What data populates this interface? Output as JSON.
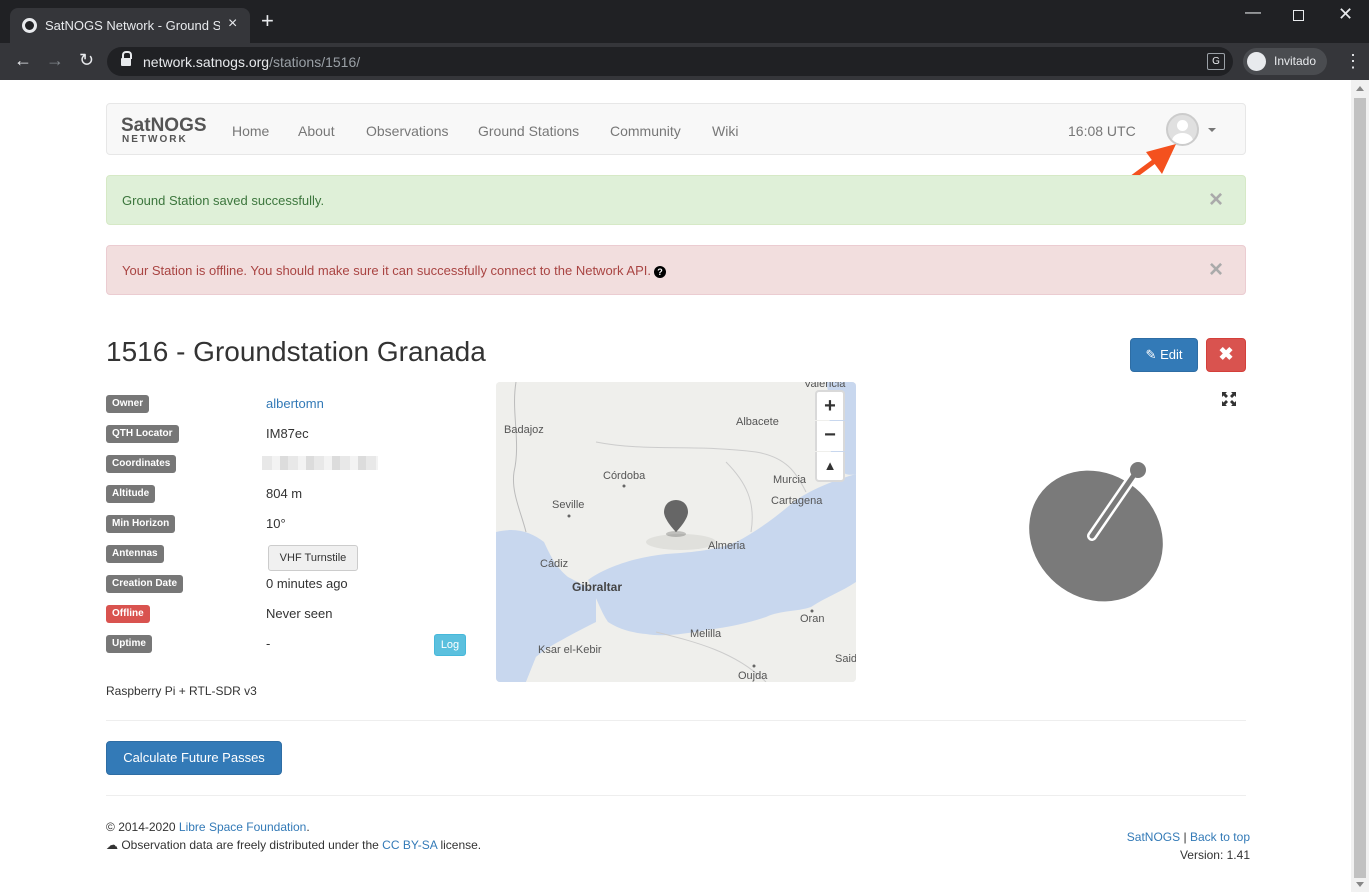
{
  "browser": {
    "tab_title": "SatNOGS Network - Ground Stati",
    "url_host": "network.satnogs.org",
    "url_path": "/stations/1516/",
    "profile_label": "Invitado"
  },
  "navbar": {
    "brand_top": "SatNOGS",
    "brand_bottom": "NETWORK",
    "links": [
      "Home",
      "About",
      "Observations",
      "Ground Stations",
      "Community",
      "Wiki"
    ],
    "clock": "16:08 UTC"
  },
  "alerts": {
    "success": "Ground Station saved successfully.",
    "danger": "Your Station is offline. You should make sure it can successfully connect to the Network API."
  },
  "station": {
    "title": "1516 - Groundstation Granada",
    "edit_label": "Edit",
    "delete_label": "✖",
    "fields": [
      {
        "label": "Owner",
        "value": "albertomn"
      },
      {
        "label": "QTH Locator",
        "value": "IM87ec"
      },
      {
        "label": "Coordinates",
        "value": ""
      },
      {
        "label": "Altitude",
        "value": "804 m"
      },
      {
        "label": "Min Horizon",
        "value": "10°"
      },
      {
        "label": "Antennas",
        "value": "VHF Turnstile"
      },
      {
        "label": "Creation Date",
        "value": "0 minutes ago"
      },
      {
        "label": "Offline",
        "value": "Never seen"
      },
      {
        "label": "Uptime",
        "value": "-"
      }
    ],
    "log_label": "Log",
    "description": "Raspberry Pi + RTL-SDR v3"
  },
  "map": {
    "cities": [
      "Valencia",
      "Badajoz",
      "Albacete",
      "Córdoba",
      "Murcia",
      "Seville",
      "Cartagena",
      "Almeria",
      "Cádiz",
      "Gibraltar",
      "Oran",
      "Melilla",
      "Ksar el-Kebir",
      "Said",
      "Oujda"
    ],
    "zoom_in": "+",
    "zoom_out": "−",
    "north": "▲"
  },
  "actions": {
    "calculate_label": "Calculate Future Passes"
  },
  "footer": {
    "copyright_prefix": "2014-2020",
    "lsf_link": "Libre Space Foundation",
    "data_text_prefix": "Observation data are freely distributed under the",
    "license_link": "CC BY-SA",
    "data_text_suffix": "license.",
    "satnogs_link": "SatNOGS",
    "separator": "|",
    "back_to_top": "Back to top",
    "version": "Version: 1.41"
  },
  "colors": {
    "primary": "#337ab7",
    "danger": "#d9534f",
    "info": "#5bc0de",
    "annotation_arrow": "#f4511e"
  }
}
